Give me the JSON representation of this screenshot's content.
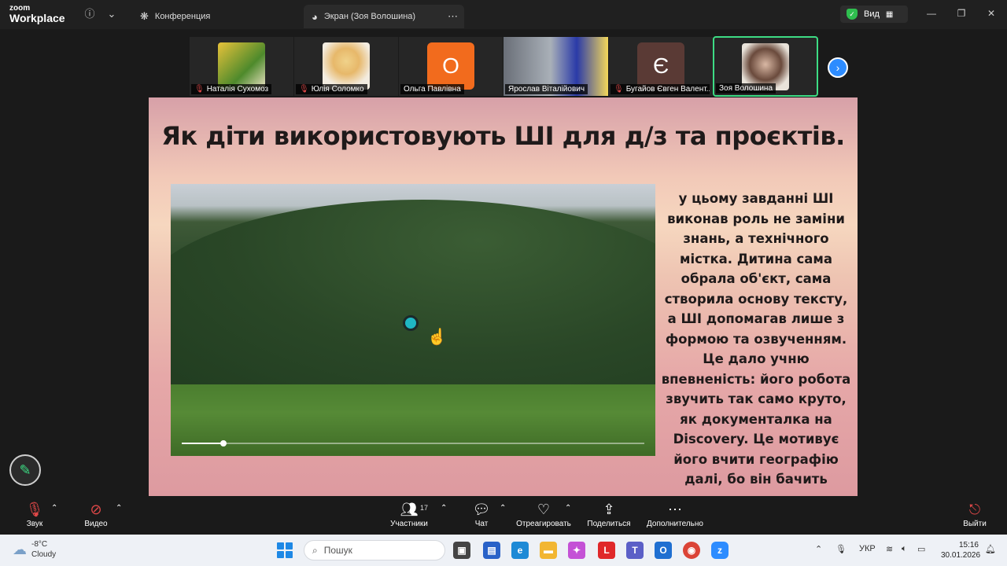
{
  "app": {
    "brand_line1": "zoom",
    "brand_line2": "Workplace"
  },
  "titlebar": {
    "tabs": [
      {
        "label": "Конференция"
      },
      {
        "label": "Экран (Зоя Волошина)"
      }
    ],
    "view_label": "Вид"
  },
  "participants": [
    {
      "name": "Наталія Сухомоз",
      "muted": true
    },
    {
      "name": "Юлія Соломко",
      "muted": true
    },
    {
      "name": "Ольга Павлівна",
      "muted": false,
      "initial": "О",
      "color": "#f26b1d"
    },
    {
      "name": "Ярослав Віталійович",
      "muted": false
    },
    {
      "name": "Бугайов Євген Валент...",
      "muted": true,
      "initial": "Є",
      "color": "#5a3a35"
    },
    {
      "name": "Зоя Волошина",
      "muted": false
    }
  ],
  "slide": {
    "title": "Як діти використовують ШІ для д/з та проєктів.",
    "text": "у цьому завданні ШІ виконав роль не заміни знань, а технічного містка. Дитина сама обрала об'єкт, сама створила основу тексту, а ШІ допомагав лише з формою та озвученням. Це дало учню впевненість: його робота звучить так само круто, як документалка на Discovery. Це мотивує його вчити географію далі, бо він бачить результат, яким може пишатися.",
    "video_progress": 0.09
  },
  "toolbar": {
    "audio": "Звук",
    "video": "Видео",
    "participants": "Участники",
    "participants_count": "17",
    "chat": "Чат",
    "react": "Отреагировать",
    "share": "Поделиться",
    "more": "Дополнительно",
    "leave": "Выйти"
  },
  "taskbar": {
    "temperature": "-8°C",
    "weather": "Cloudy",
    "search_placeholder": "Пошук",
    "language": "УКР",
    "time": "15:16",
    "date": "30.01.2026"
  }
}
